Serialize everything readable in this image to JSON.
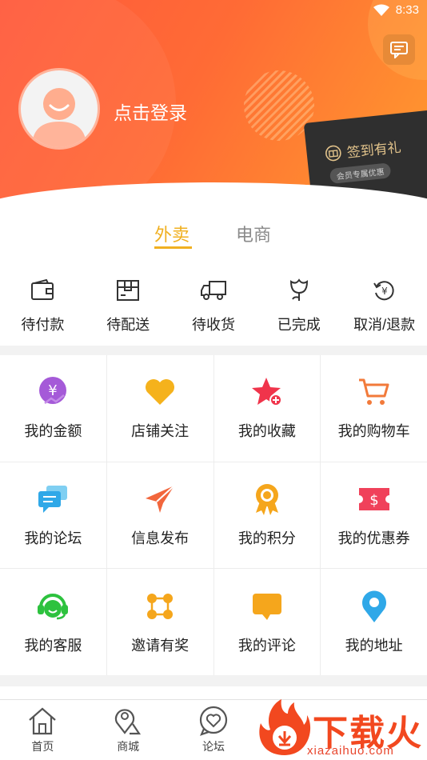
{
  "status_bar": {
    "time": "8:33"
  },
  "header": {
    "login_text": "点击登录"
  },
  "promo_card": {
    "title": "签到有礼",
    "subtitle": "会员专属优惠"
  },
  "tabs": [
    {
      "label": "外卖",
      "active": true
    },
    {
      "label": "电商",
      "active": false
    }
  ],
  "orders": [
    {
      "label": "待付款",
      "icon": "wallet-icon"
    },
    {
      "label": "待配送",
      "icon": "package-icon"
    },
    {
      "label": "待收货",
      "icon": "truck-icon"
    },
    {
      "label": "已完成",
      "icon": "flower-icon"
    },
    {
      "label": "取消/退款",
      "icon": "refund-icon"
    }
  ],
  "grid": [
    {
      "label": "我的金额",
      "icon": "yuan-icon",
      "color": "#a55ad8"
    },
    {
      "label": "店铺关注",
      "icon": "heart-icon",
      "color": "#f5b21c"
    },
    {
      "label": "我的收藏",
      "icon": "star-icon",
      "color": "#f0344b"
    },
    {
      "label": "我的购物车",
      "icon": "cart-icon",
      "color": "#f27a3a"
    },
    {
      "label": "我的论坛",
      "icon": "chat-icon",
      "color": "#2fa8e8"
    },
    {
      "label": "信息发布",
      "icon": "send-icon",
      "color": "#f2663c"
    },
    {
      "label": "我的积分",
      "icon": "medal-icon",
      "color": "#f5a61c"
    },
    {
      "label": "我的优惠券",
      "icon": "coupon-icon",
      "color": "#f0415a"
    },
    {
      "label": "我的客服",
      "icon": "headset-icon",
      "color": "#2dc23e"
    },
    {
      "label": "邀请有奖",
      "icon": "network-icon",
      "color": "#f5a61c"
    },
    {
      "label": "我的评论",
      "icon": "comment-icon",
      "color": "#f5a61c"
    },
    {
      "label": "我的地址",
      "icon": "location-icon",
      "color": "#2fa8e8"
    }
  ],
  "bottom_nav": [
    {
      "label": "首页",
      "icon": "home-icon"
    },
    {
      "label": "商城",
      "icon": "map-icon"
    },
    {
      "label": "论坛",
      "icon": "forum-icon"
    }
  ],
  "watermark": {
    "brand": "下载火",
    "url": "xiazaihuo.com"
  }
}
